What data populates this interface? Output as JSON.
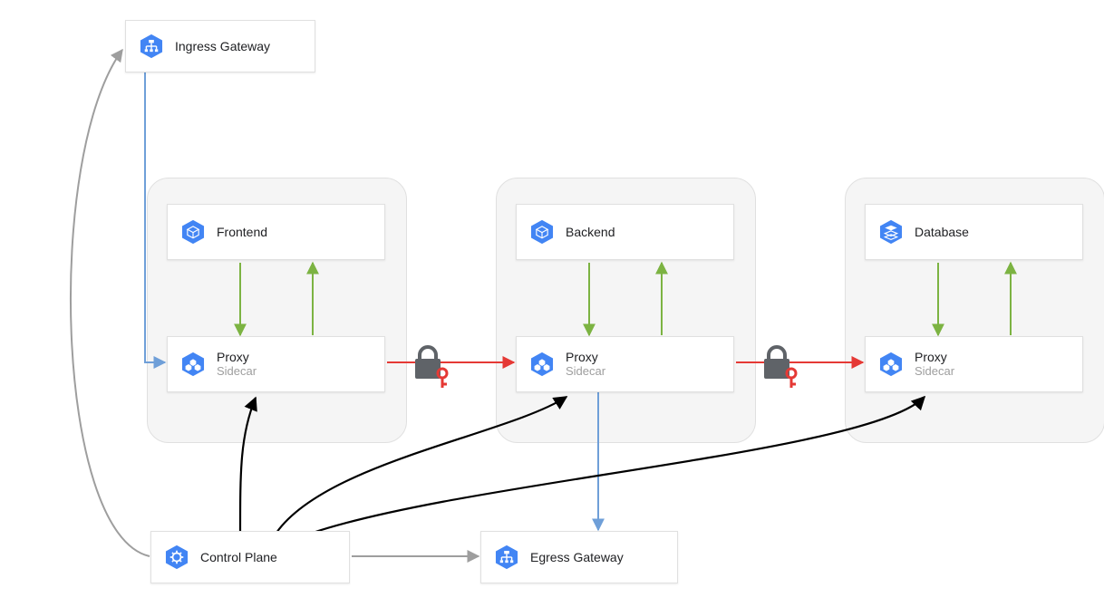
{
  "colors": {
    "blue": "#4285f4",
    "arrow_blue": "#6f9fd8",
    "arrow_gray": "#9e9e9e",
    "arrow_black": "#000000",
    "arrow_green": "#7cb342",
    "arrow_red": "#e53935",
    "lock_body": "#5f6368",
    "pod_bg": "#f5f5f5"
  },
  "nodes": {
    "ingress": {
      "label": "Ingress Gateway"
    },
    "egress": {
      "label": "Egress Gateway"
    },
    "control": {
      "label": "Control Plane"
    },
    "frontend": {
      "title": "Frontend"
    },
    "backend": {
      "title": "Backend"
    },
    "database": {
      "title": "Database"
    },
    "proxy1": {
      "title": "Proxy",
      "sub": "Sidecar"
    },
    "proxy2": {
      "title": "Proxy",
      "sub": "Sidecar"
    },
    "proxy3": {
      "title": "Proxy",
      "sub": "Sidecar"
    }
  },
  "icons": {
    "ingress": "lb-icon",
    "egress": "lb-icon",
    "frontend": "cube-icon",
    "backend": "cube-icon",
    "database": "stack-icon",
    "proxy": "mesh-icon",
    "control": "gear-icon"
  }
}
